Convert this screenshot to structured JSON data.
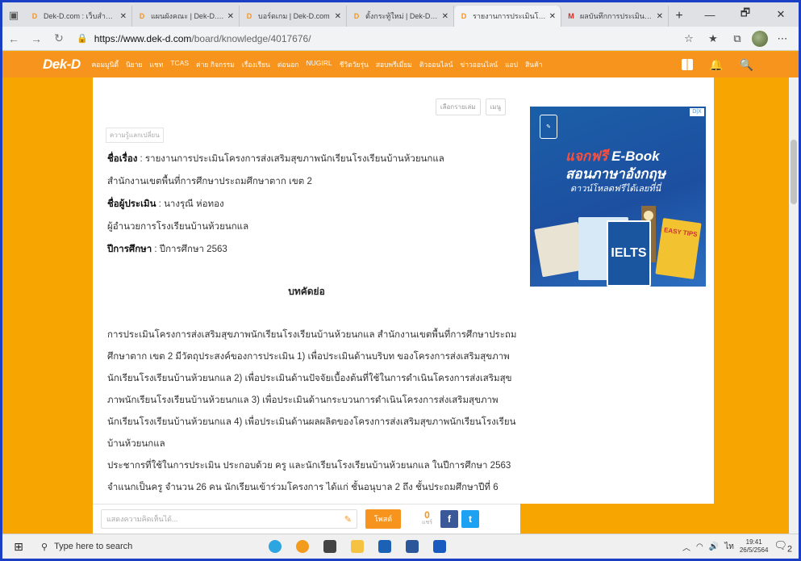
{
  "browser": {
    "tabs": [
      {
        "fav": "D",
        "title": "Dek-D.com : เว็บสำหรับวัยรุ่น"
      },
      {
        "fav": "D",
        "title": "แผนผังคณะ | Dek-D.com"
      },
      {
        "fav": "D",
        "title": "บอร์ดเกม | Dek-D.com"
      },
      {
        "fav": "D",
        "title": "ตั้งกระทู้ใหม่ | Dek-D.com"
      },
      {
        "fav": "D",
        "title": "รายงานการประเมินโครงการ",
        "active": true
      },
      {
        "fav": "M",
        "title": "ผลบันทึกการประเมินบ้านทัก"
      }
    ],
    "new_tab": "+",
    "window_controls": [
      "—",
      "🗗",
      "✕"
    ],
    "url_host": "https://www.dek-d.com",
    "url_path": "/board/knowledge/4017676/"
  },
  "site": {
    "logo": "Dek-D",
    "nav": [
      "คอมมูนิตี้",
      "นิยาย",
      "แชท",
      "TCAS",
      "ค่าย กิจกรรม",
      "เรื่องเรียน",
      "ต่อนอก",
      "NUGIRL",
      "ชีวิตวัยรุ่น",
      "สอบพรีเมี่ยม",
      "ติวออนไลน์",
      "ข่าวออนไลน์",
      "แอป",
      "สินค้า"
    ]
  },
  "article": {
    "actions": [
      "เลือกรายเล่ม",
      "เมนู"
    ],
    "tag": "ความรู้แลกเปลี่ยน",
    "lines": [
      {
        "label": "ชื่อเรื่อง",
        "text": "  : รายงานการประเมินโครงการส่งเสริมสุขภาพนักเรียนโรงเรียนบ้านห้วยนกแล"
      },
      {
        "label": "",
        "text": "  สำนักงานเขตพื้นที่การศึกษาประถมศึกษาตาก เขต 2"
      },
      {
        "label": "ชื่อผู้ประเมิน",
        "text": " : นางรุณี ห่อทอง"
      },
      {
        "label": "",
        "text": "  ผู้อำนวยการโรงเรียนบ้านห้วยนกแล"
      },
      {
        "label": "ปีการศึกษา",
        "text": "  : ปีการศึกษา 2563"
      }
    ],
    "abstract_title": "บทคัดย่อ",
    "paragraphs": [
      "  การประเมินโครงการส่งเสริมสุขภาพนักเรียนโรงเรียนบ้านห้วยนกแล สำนักงานเขตพื้นที่การศึกษาประถม",
      "ศึกษาตาก เขต 2 มีวัตถุประสงค์ของการประเมิน 1) เพื่อประเมินด้านบริบท ของโครงการส่งเสริมสุขภาพ",
      "นักเรียนโรงเรียนบ้านห้วยนกแล 2) เพื่อประเมินด้านปัจจัยเบื้องต้นที่ใช้ในการดำเนินโครงการส่งเสริมสุข",
      "ภาพนักเรียนโรงเรียนบ้านห้วยนกแล 3) เพื่อประเมินด้านกระบวนการดำเนินโครงการส่งเสริมสุขภาพ",
      "นักเรียนโรงเรียนบ้านห้วยนกแล 4) เพื่อประเมินด้านผลผลิตของโครงการส่งเสริมสุขภาพนักเรียนโรงเรียน",
      "บ้านห้วยนกแล",
      "  ประชากรที่ใช้ในการประเมิน ประกอบด้วย ครู และนักเรียนโรงเรียนบ้านห้วยนกแล ในปีการศึกษา 2563",
      "จำแนกเป็นครู จำนวน 26 คน นักเรียนเข้าร่วมโครงการ ได้แก่ ชั้นอนุบาล 2 ถึง ชั้นประถมศึกษาปีที่ 6"
    ]
  },
  "ad": {
    "badge": "D|X",
    "headline_red": "แจกฟรี",
    "headline_white": " E-Book",
    "headline2": "สอนภาษาอังกฤษ",
    "headline3": "ดาวน์โหลดฟรีได้เลยที่นี่",
    "book_label": "IELTS",
    "book2_label": "EASY TIPS"
  },
  "comment": {
    "placeholder": "แสดงความคิดเห็นได้...",
    "send": "โพสต์",
    "count": "0",
    "count_label": "แชร์"
  },
  "taskbar": {
    "search": "Type here to search",
    "time": "19:41",
    "date": "26/5/2564",
    "notif_count": "2"
  }
}
